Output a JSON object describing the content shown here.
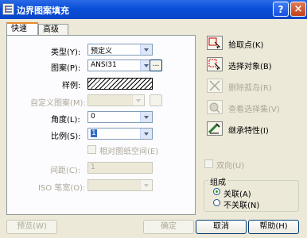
{
  "window": {
    "title": "边界图案填充",
    "help_symbol": "?",
    "close_symbol": "×"
  },
  "tabs": [
    {
      "label": "快速"
    },
    {
      "label": "高级"
    }
  ],
  "form": {
    "type_label": "类型(Y):",
    "type_value": "预定义",
    "pattern_label": "图案(P):",
    "pattern_value": "ANSI31",
    "pattern_browse": "...",
    "sample_label": "样例:",
    "custom_pattern_label": "自定义图案(M):",
    "angle_label": "角度(L):",
    "angle_value": "0",
    "scale_label": "比例(S):",
    "scale_value": "1",
    "relative_label": "相对图纸空间(E)",
    "spacing_label": "间距(C):",
    "spacing_value": "1",
    "iso_label": "ISO 笔宽(O):"
  },
  "right_panel": {
    "pick_points": "拾取点(K)",
    "select_objects": "选择对象(B)",
    "remove_islands": "删除孤岛(R)",
    "view_selections": "查看选择集(V)",
    "inherit_properties": "继承特性(I)",
    "double_label": "双向(U)",
    "composition_title": "组成",
    "associative": "关联(A)",
    "nonassociative": "不关联(N)"
  },
  "footer": {
    "preview": "预览(W)",
    "ok": "确定",
    "cancel": "取消",
    "help": "帮助(H)"
  }
}
